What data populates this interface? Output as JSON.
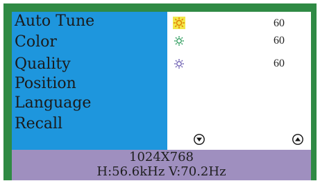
{
  "menu": {
    "items": [
      {
        "label": "Auto Tune"
      },
      {
        "label": "Color"
      },
      {
        "label": "Quality"
      },
      {
        "label": "Position"
      },
      {
        "label": "Language"
      },
      {
        "label": "Recall"
      }
    ]
  },
  "values": [
    {
      "icon": "sun-icon",
      "icon_color": "#e07b00",
      "highlight": "#f2e84a",
      "value": "60"
    },
    {
      "icon": "sun-outline-icon",
      "icon_color": "#2a9a5a",
      "value": "60"
    },
    {
      "icon": "sun-outline-icon",
      "icon_color": "#6a5ab0",
      "value": "60"
    }
  ],
  "nav": {
    "down": "down-arrow-icon",
    "up": "up-arrow-icon"
  },
  "status": {
    "resolution": "1024X768",
    "frequency": "H:56.6kHz V:70.2Hz"
  },
  "colors": {
    "frame": "#2f8a44",
    "menu_bg": "#1e96dd",
    "status_bg": "#9f8fbf"
  }
}
